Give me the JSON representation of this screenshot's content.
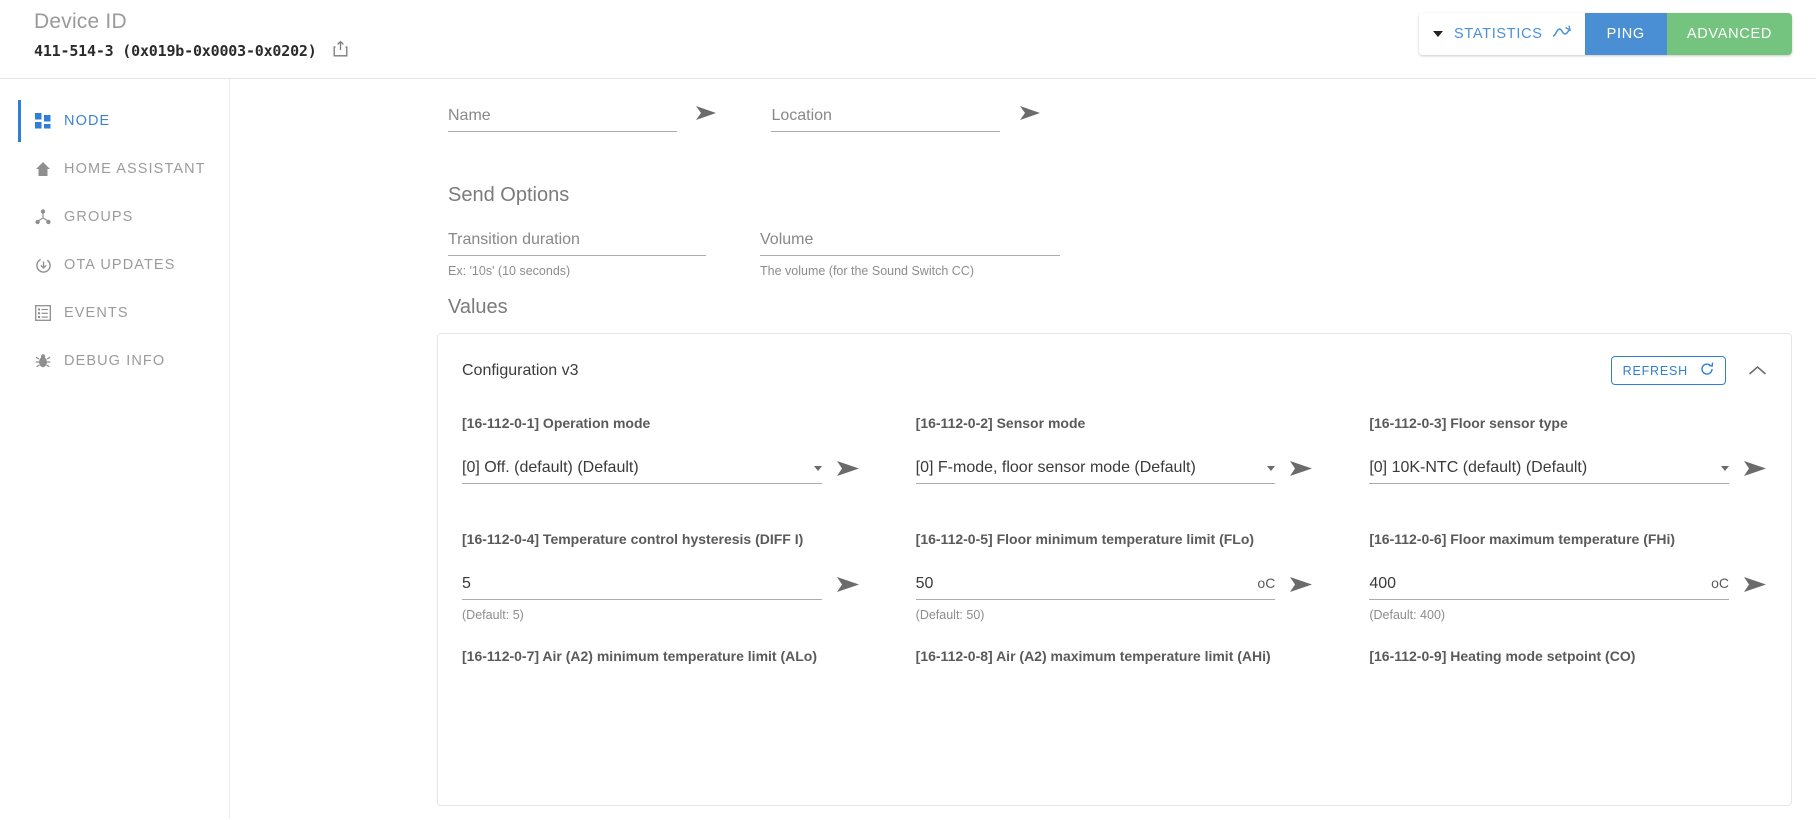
{
  "header": {
    "device_id_label": "Device ID",
    "device_id_value": "411-514-3 (0x019b-0x0003-0x0202)",
    "share_icon": "share-icon",
    "buttons": {
      "statistics": "STATISTICS",
      "ping": "PING",
      "advanced": "ADVANCED"
    },
    "colors": {
      "statistics_text": "#4a90d9",
      "ping_bg": "#4a8fd4",
      "advanced_bg": "#74c37f"
    }
  },
  "sidebar": {
    "items": [
      {
        "label": "NODE",
        "icon": "grid-icon",
        "active": true
      },
      {
        "label": "HOME ASSISTANT",
        "icon": "home-icon",
        "active": false
      },
      {
        "label": "GROUPS",
        "icon": "groups-icon",
        "active": false
      },
      {
        "label": "OTA UPDATES",
        "icon": "update-icon",
        "active": false
      },
      {
        "label": "EVENTS",
        "icon": "list-icon",
        "active": false
      },
      {
        "label": "DEBUG INFO",
        "icon": "bug-icon",
        "active": false
      }
    ]
  },
  "main": {
    "name_field": {
      "placeholder": "Name",
      "value": ""
    },
    "location_field": {
      "placeholder": "Location",
      "value": ""
    },
    "send_options_title": "Send Options",
    "transition_field": {
      "placeholder": "Transition duration",
      "value": "",
      "hint": "Ex: '10s' (10 seconds)"
    },
    "volume_field": {
      "placeholder": "Volume",
      "value": "",
      "hint": "The volume (for the Sound Switch CC)"
    },
    "values_title": "Values",
    "card": {
      "title": "Configuration v3",
      "refresh_label": "REFRESH",
      "refresh_icon": "refresh-icon",
      "collapse_icon": "chevron-up-icon",
      "params": [
        {
          "label": "[16-112-0-1] Operation mode",
          "type": "select",
          "value": "[0] Off. (default) (Default)",
          "unit": "",
          "default_text": ""
        },
        {
          "label": "[16-112-0-2] Sensor mode",
          "type": "select",
          "value": "[0] F-mode, floor sensor mode (Default)",
          "unit": "",
          "default_text": ""
        },
        {
          "label": "[16-112-0-3] Floor sensor type",
          "type": "select",
          "value": "[0] 10K-NTC (default) (Default)",
          "unit": "",
          "default_text": ""
        },
        {
          "label": "[16-112-0-4] Temperature control hysteresis (DIFF I)",
          "type": "text",
          "value": "5",
          "unit": "",
          "default_text": "(Default: 5)"
        },
        {
          "label": "[16-112-0-5] Floor minimum temperature limit (FLo)",
          "type": "text",
          "value": "50",
          "unit": "oC",
          "default_text": "(Default: 50)"
        },
        {
          "label": "[16-112-0-6] Floor maximum temperature (FHi)",
          "type": "text",
          "value": "400",
          "unit": "oC",
          "default_text": "(Default: 400)"
        },
        {
          "label": "[16-112-0-7] Air (A2) minimum temperature limit (ALo)",
          "type": "text",
          "value": "",
          "unit": "",
          "default_text": ""
        },
        {
          "label": "[16-112-0-8] Air (A2) maximum temperature limit (AHi)",
          "type": "text",
          "value": "",
          "unit": "",
          "default_text": ""
        },
        {
          "label": "[16-112-0-9] Heating mode setpoint (CO)",
          "type": "text",
          "value": "",
          "unit": "",
          "default_text": ""
        }
      ]
    }
  }
}
